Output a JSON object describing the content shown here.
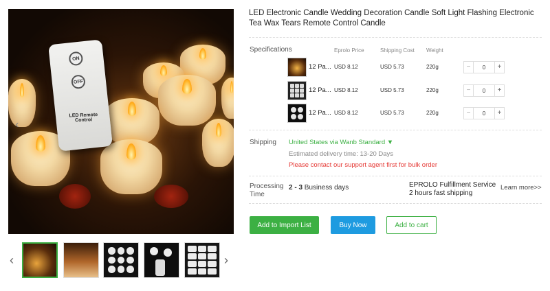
{
  "product": {
    "title": "LED Electronic Candle Wedding Decoration Candle Soft Light Flashing Electronic Tea Wax Tears Remote Control Candle"
  },
  "gallery": {
    "remote": {
      "on_label": "ON",
      "off_label": "OFF",
      "text": "LED Remote Control"
    },
    "prev_icon": "‹",
    "next_icon": "›",
    "main_prev_icon": "‹",
    "thumbnails": [
      {
        "id": "thumb-1",
        "active": true
      },
      {
        "id": "thumb-2",
        "active": false
      },
      {
        "id": "thumb-3",
        "active": false
      },
      {
        "id": "thumb-4",
        "active": false
      },
      {
        "id": "thumb-5",
        "active": false
      }
    ]
  },
  "specifications": {
    "label": "Specifications",
    "columns": {
      "price": "Eprolo Price",
      "shipping": "Shipping Cost",
      "weight": "Weight"
    },
    "rows": [
      {
        "name": "12 Pa...",
        "price": "USD 8.12",
        "shipping": "USD 5.73",
        "weight": "220g",
        "qty": "0"
      },
      {
        "name": "12 Pa...",
        "price": "USD 8.12",
        "shipping": "USD 5.73",
        "weight": "220g",
        "qty": "0"
      },
      {
        "name": "12 Pa...",
        "price": "USD 8.12",
        "shipping": "USD 5.73",
        "weight": "220g",
        "qty": "0"
      }
    ],
    "minus": "−",
    "plus": "+"
  },
  "shipping": {
    "label": "Shipping",
    "method": "United States via Wanb Standard ▼",
    "estimate": "Estimated delivery time: 13-20 Days",
    "warning": "Please contact our support agent first for bulk order"
  },
  "processing": {
    "label_line1": "Processing",
    "label_line2": "Time",
    "days_bold": "2 - 3",
    "days_text": " Business days",
    "service_title": "EPROLO Fulfillment Service",
    "service_sub": "2 hours fast shipping",
    "learn_more": "Learn more>>"
  },
  "actions": {
    "import": "Add to Import List",
    "buy": "Buy Now",
    "cart": "Add to cart"
  },
  "colors": {
    "primary_green": "#3cb043",
    "buy_blue": "#1e9be0",
    "warning_red": "#e53935"
  }
}
